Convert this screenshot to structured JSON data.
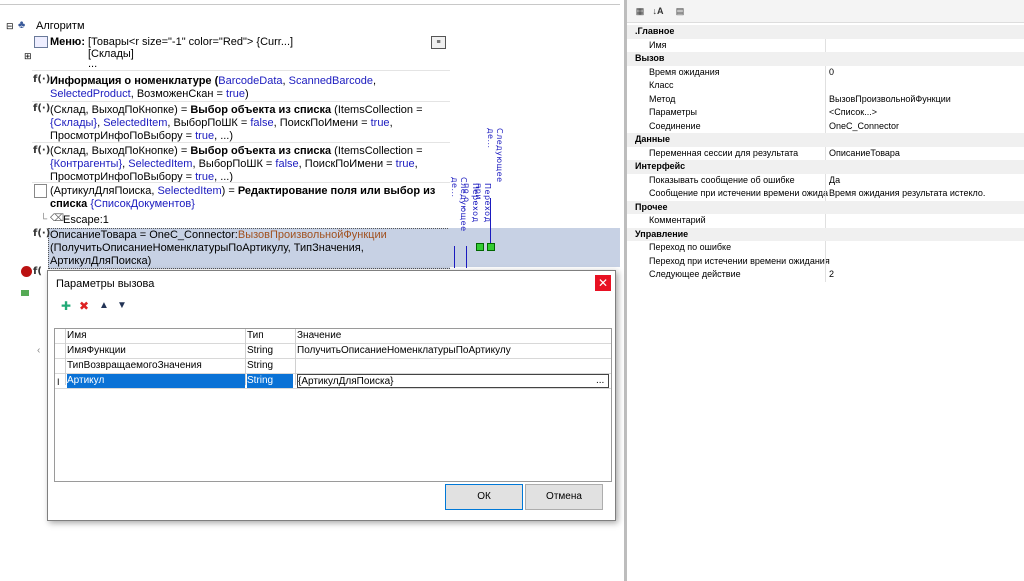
{
  "tree": {
    "root_label": "Алгоритм",
    "menu_node": {
      "label": "Меню:",
      "line1": "[Товары<r size=\"-1\" color=\"Red\"> {Curr...]",
      "line2": "[Склады]",
      "line3": "..."
    },
    "info_node": {
      "prefix": "Информация о номенклатуре",
      "open": " (",
      "a1": "BarcodeData",
      "c1": ", ",
      "a2": "ScannedBarcode",
      "c2": ",",
      "a3": "SelectedProduct",
      "c3": ", ВозможенСкан = ",
      "a4": "true",
      "close": ")"
    },
    "select1": {
      "lhs": "(Склад, ВыходПоКнопке) = ",
      "name": "Выбор объекта из списка",
      "args1": " (ItemsCollection =",
      "args2a": "{Склады}",
      "args2b": ", ",
      "args2c": "SelectedItem",
      "args2d": ", ВыборПоШК = ",
      "args2e": "false",
      "args2f": ", ПоискПоИмени = ",
      "args2g": "true",
      "args2h": ",",
      "args3a": "ПросмотрИнфоПоВыбору = ",
      "args3b": "true",
      "args3c": ", ...)"
    },
    "select2": {
      "lhs": "(Склад, ВыходПоКнопке) = ",
      "name": "Выбор объекта из списка",
      "args1": " (ItemsCollection =",
      "args2a": "{Контрагенты}",
      "args2b": ", ",
      "args2c": "SelectedItem",
      "args2d": ", ВыборПоШК = ",
      "args2e": "false",
      "args2f": ", ПоискПоИмени = ",
      "args2g": "true",
      "args2h": ",",
      "args3a": "ПросмотрИнфоПоВыбору = ",
      "args3b": "true",
      "args3c": ", ...)"
    },
    "edit_node": {
      "lhs1": "(АртикулДляПоиска, ",
      "lhs2": "SelectedItem",
      "lhs3": ") = ",
      "name1": "Редактирование поля или выбор из",
      "name2": "списка",
      "arg": " {СписокДокументов}"
    },
    "escape_label": "Escape:1",
    "call_node": {
      "lhs": "ОписаниеТовара = OneC_Connector:",
      "method": "ВызовПроизвольнойФункции",
      "line2": "(ПолучитьОписаниеНоменклатурыПоАртикулу, ТипЗначения,",
      "line3": "АртикулДляПоиска)"
    },
    "vlabels": [
      "Следующее де...",
      "Переход по о...",
      "Переход при...",
      "Следующее де..."
    ]
  },
  "properties": {
    "rows": [
      {
        "type": "cat",
        "key": ".Главное"
      },
      {
        "type": "row",
        "key": "Имя",
        "value": ""
      },
      {
        "type": "cat",
        "key": "Вызов"
      },
      {
        "type": "row",
        "key": "Время ожидания",
        "value": "0"
      },
      {
        "type": "row",
        "key": "Класс",
        "value": ""
      },
      {
        "type": "row",
        "key": "Метод",
        "value": "ВызовПроизвольнойФункции"
      },
      {
        "type": "row",
        "key": "Параметры",
        "value": "<Список...>"
      },
      {
        "type": "row",
        "key": "Соединение",
        "value": "OneC_Connector"
      },
      {
        "type": "cat",
        "key": "Данные"
      },
      {
        "type": "row",
        "key": "Переменная сессии для результата",
        "value": "ОписаниеТовара"
      },
      {
        "type": "cat",
        "key": "Интерфейс"
      },
      {
        "type": "row",
        "key": "Показывать сообщение об ошибке",
        "value": "Да"
      },
      {
        "type": "row",
        "key": "Сообщение при истечении времени ожида",
        "value": "Время ожидания результата истекло."
      },
      {
        "type": "cat",
        "key": "Прочее"
      },
      {
        "type": "row",
        "key": "Комментарий",
        "value": ""
      },
      {
        "type": "cat",
        "key": "Управление"
      },
      {
        "type": "row",
        "key": "Переход по ошибке",
        "value": ""
      },
      {
        "type": "row",
        "key": "Переход при истечении времени ожидания",
        "value": ""
      },
      {
        "type": "row",
        "key": "Следующее действие",
        "value": "2"
      }
    ]
  },
  "dialog": {
    "title": "Параметры вызова",
    "columns": {
      "name": "Имя",
      "type": "Тип",
      "value": "Значение"
    },
    "rows": [
      {
        "name": "ИмяФункции",
        "type": "String",
        "value": "ПолучитьОписаниеНоменклатурыПоАртикулу"
      },
      {
        "name": "ТипВозвращаемогоЗначения",
        "type": "String",
        "value": ""
      },
      {
        "name": "Артикул",
        "type": "String",
        "value": "{АртикулДляПоиска}"
      }
    ],
    "ellipsis": "...",
    "ok_label": "ОК",
    "cancel_label": "Отмена",
    "close_glyph": "✕"
  },
  "colors": {
    "accent": "#0a72d6",
    "close": "#e81123",
    "keyword": "#1b1bbf",
    "method": "#a0501e"
  }
}
